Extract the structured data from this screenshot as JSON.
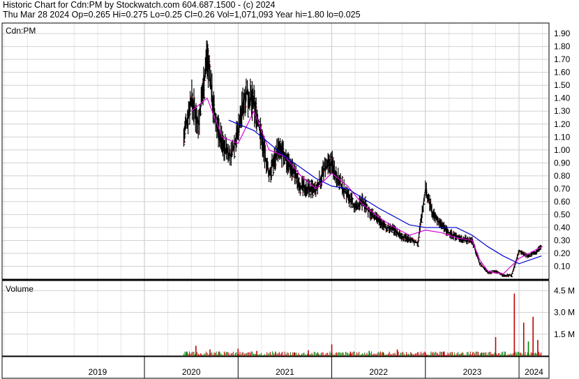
{
  "header": {
    "line1": "Historic Chart for Cdn:PM by Stockwatch.com 604.687.1500 - (c) 2024",
    "line2": "Thu Mar 28 2024   Op=0.265   Hi=0.275   Lo=0.25   Cl=0.26   Vol=1,071,093   Year hi=1.80   lo=0.025"
  },
  "chart_data": [
    {
      "type": "line",
      "title": "Cdn:PM",
      "ylim": [
        0,
        1.96
      ],
      "y_tick_labels": [
        "1.90",
        "1.80",
        "1.70",
        "1.60",
        "1.50",
        "1.40",
        "1.30",
        "1.20",
        "1.10",
        "1.00",
        "0.90",
        "0.80",
        "0.70",
        "0.60",
        "0.50",
        "0.40",
        "0.30",
        "0.20",
        "0.10"
      ],
      "x_tick_labels": [
        "2019",
        "2020",
        "2021",
        "2022",
        "2023",
        "2024"
      ],
      "series": [
        {
          "kind": "price",
          "color": "#000000",
          "x": [
            2020.42,
            2020.5,
            2020.58,
            2020.67,
            2020.75,
            2020.83,
            2020.92,
            2021.0,
            2021.08,
            2021.17,
            2021.25,
            2021.33,
            2021.42,
            2021.5,
            2021.58,
            2021.67,
            2021.75,
            2021.83,
            2021.92,
            2022.0,
            2022.08,
            2022.17,
            2022.25,
            2022.33,
            2022.42,
            2022.5,
            2022.58,
            2022.67,
            2022.75,
            2022.83,
            2022.92,
            2023.0,
            2023.08,
            2023.17,
            2023.25,
            2023.33,
            2023.42,
            2023.5,
            2023.58,
            2023.67,
            2023.75,
            2023.83,
            2023.92,
            2024.0,
            2024.08,
            2024.17,
            2024.24
          ],
          "y": [
            1.1,
            1.4,
            1.2,
            1.75,
            1.25,
            1.05,
            0.95,
            1.15,
            1.45,
            1.35,
            1.1,
            0.8,
            1.0,
            0.95,
            0.85,
            0.72,
            0.7,
            0.68,
            0.85,
            0.9,
            0.75,
            0.65,
            0.55,
            0.6,
            0.5,
            0.45,
            0.4,
            0.38,
            0.33,
            0.31,
            0.28,
            0.7,
            0.5,
            0.42,
            0.36,
            0.33,
            0.31,
            0.3,
            0.12,
            0.05,
            0.06,
            0.03,
            0.03,
            0.22,
            0.18,
            0.2,
            0.26
          ]
        },
        {
          "kind": "moving-average",
          "color": "#d600d6",
          "x": [
            2020.5,
            2020.67,
            2020.83,
            2021.0,
            2021.17,
            2021.33,
            2021.5,
            2021.67,
            2021.83,
            2022.0,
            2022.17,
            2022.33,
            2022.5,
            2022.67,
            2022.83,
            2023.0,
            2023.17,
            2023.33,
            2023.5,
            2023.58,
            2023.67,
            2023.83,
            2024.0,
            2024.24
          ],
          "y": [
            1.3,
            1.4,
            1.1,
            1.05,
            1.3,
            1.0,
            0.95,
            0.8,
            0.7,
            0.82,
            0.72,
            0.58,
            0.48,
            0.4,
            0.34,
            0.38,
            0.36,
            0.32,
            0.3,
            0.15,
            0.06,
            0.04,
            0.16,
            0.25
          ]
        },
        {
          "kind": "moving-average",
          "color": "#0000cc",
          "x": [
            2020.9,
            2021.17,
            2021.5,
            2021.83,
            2022.0,
            2022.17,
            2022.5,
            2022.83,
            2023.0,
            2023.33,
            2023.5,
            2023.67,
            2023.83,
            2024.0,
            2024.24
          ],
          "y": [
            1.23,
            1.15,
            0.95,
            0.78,
            0.72,
            0.7,
            0.55,
            0.42,
            0.4,
            0.4,
            0.34,
            0.25,
            0.18,
            0.12,
            0.18
          ]
        }
      ]
    },
    {
      "type": "bar",
      "title": "Volume",
      "y_tick_labels": [
        "4.5 M",
        "3.0 M",
        "1.5 M"
      ],
      "ylim": [
        0,
        5000000
      ],
      "x": [
        2020.45,
        2020.55,
        2020.7,
        2020.8,
        2021.0,
        2021.2,
        2021.4,
        2021.6,
        2021.75,
        2021.85,
        2022.0,
        2022.2,
        2022.4,
        2022.55,
        2022.7,
        2022.85,
        2023.0,
        2023.2,
        2023.4,
        2023.6,
        2023.75,
        2023.85,
        2023.95,
        2024.05,
        2024.1,
        2024.15,
        2024.2
      ],
      "values": [
        300000,
        700000,
        450000,
        300000,
        500000,
        350000,
        300000,
        250000,
        400000,
        250000,
        800000,
        300000,
        350000,
        250000,
        450000,
        200000,
        250000,
        300000,
        200000,
        200000,
        1300000,
        300000,
        4300000,
        2300000,
        1000000,
        2700000,
        1100000
      ]
    }
  ]
}
